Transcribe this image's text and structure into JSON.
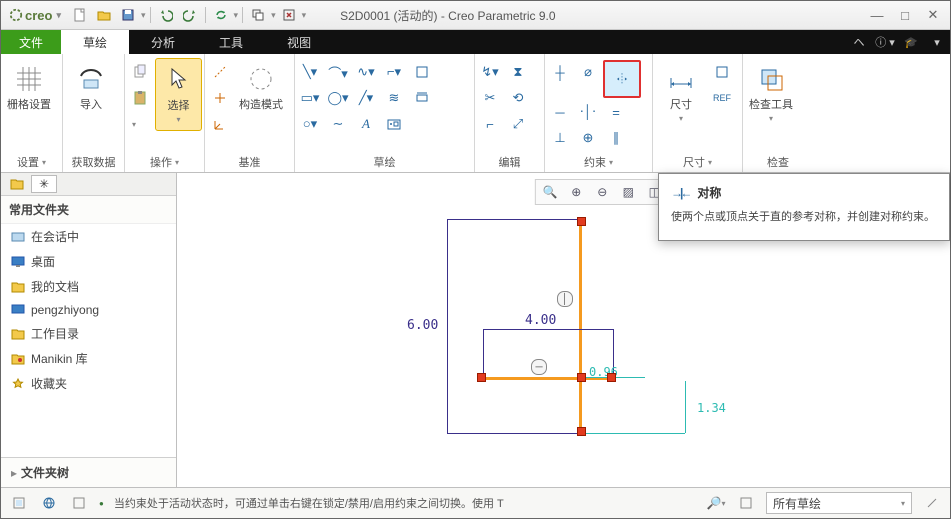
{
  "titlebar": {
    "brand": "creo",
    "title": "S2D0001 (活动的) - Creo Parametric 9.0"
  },
  "menubar": {
    "file": "文件",
    "tabs": [
      "草绘",
      "分析",
      "工具",
      "视图"
    ]
  },
  "ribbon": {
    "groups": {
      "setup": {
        "big": "栅格设置",
        "title": "设置"
      },
      "getdata": {
        "big": "导入",
        "title": "获取数据"
      },
      "ops": {
        "big": "选择",
        "title": "操作"
      },
      "datum": {
        "big": "构造模式",
        "title": "基准"
      },
      "sketch": {
        "title": "草绘"
      },
      "edit": {
        "title": "编辑"
      },
      "constrain": {
        "title": "约束"
      },
      "dim": {
        "big": "尺寸",
        "title": "尺寸"
      },
      "inspect": {
        "big": "检查工具",
        "title": "检查"
      }
    },
    "dd": "▾"
  },
  "tooltip": {
    "icon": "⇥⇤",
    "title": "对称",
    "body": "使两个点或顶点关于直的参考对称，并创建对称约束。"
  },
  "sidebar": {
    "header": "常用文件夹",
    "items": [
      {
        "icon": "session",
        "label": "在会话中"
      },
      {
        "icon": "desktop",
        "label": "桌面"
      },
      {
        "icon": "docs",
        "label": "我的文档"
      },
      {
        "icon": "pc",
        "label": "pengzhiyong"
      },
      {
        "icon": "work",
        "label": "工作目录"
      },
      {
        "icon": "manikin",
        "label": "Manikin 库"
      },
      {
        "icon": "fav",
        "label": "收藏夹"
      }
    ],
    "tree_label": "文件夹树"
  },
  "status": {
    "bullet": "●",
    "message": "当约束处于活动状态时，可通过单击右键在锁定/禁用/启用约束之间切换。使用 T",
    "filter": "所有草绘"
  },
  "sketch": {
    "dim1": "6.00",
    "dim2": "4.00",
    "cy_h": "0.96",
    "cy_v": "1.34"
  }
}
